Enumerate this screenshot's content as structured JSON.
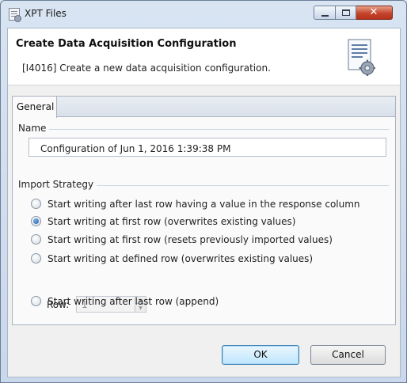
{
  "window": {
    "title": "XPT Files",
    "close_glyph": "✕"
  },
  "header": {
    "title": "Create Data Acquisition Configuration",
    "description": "[I4016] Create a new data acquisition configuration."
  },
  "tabs": [
    {
      "label": "General",
      "selected": true
    }
  ],
  "name_section": {
    "label": "Name",
    "value": "Configuration of Jun 1, 2016 1:39:38 PM"
  },
  "import_strategy": {
    "label": "Import Strategy",
    "options": [
      {
        "label": "Start writing after last row having a value in the response column",
        "checked": false
      },
      {
        "label": "Start writing at first row (overwrites existing values)",
        "checked": true
      },
      {
        "label": "Start writing at first row (resets previously imported values)",
        "checked": false
      },
      {
        "label": "Start writing at defined row (overwrites existing values)",
        "checked": false
      },
      {
        "label": "Start writing after last row (append)",
        "checked": false
      }
    ],
    "row_label": "Row:",
    "row_value": "1"
  },
  "buttons": {
    "ok": "OK",
    "cancel": "Cancel"
  },
  "icons": {
    "app": "document-gear-icon",
    "header": "configuration-document-icon"
  },
  "colors": {
    "accent": "#1f5aa8",
    "close_button": "#c4452c",
    "title_bar": "#d8e4f2"
  }
}
